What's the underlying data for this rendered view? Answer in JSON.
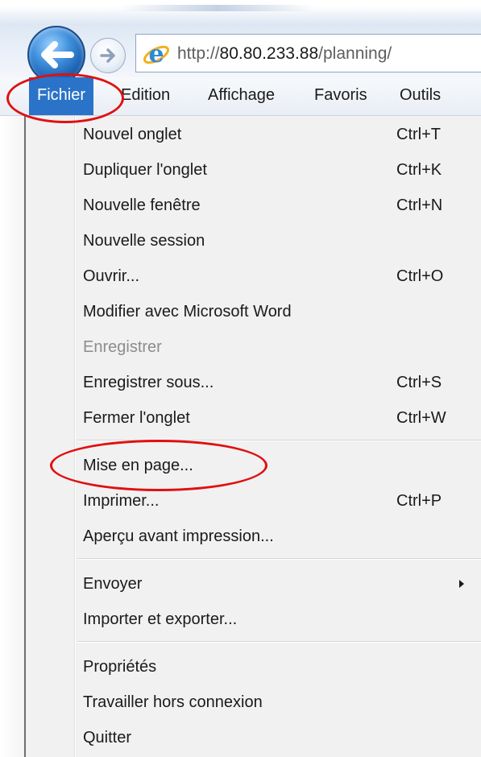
{
  "browser": {
    "address_bar": {
      "url_prefix": "http://",
      "url_host": "80.80.233.88",
      "url_path": "/planning/"
    },
    "icons": {
      "back": "back-arrow-icon",
      "forward": "forward-arrow-icon",
      "site": "internet-explorer-icon"
    },
    "accent_color": "#2b73c8",
    "highlight_color": "#e01010"
  },
  "menubar": {
    "items": [
      {
        "label": "Fichier",
        "active": true
      },
      {
        "label": "Edition"
      },
      {
        "label": "Affichage"
      },
      {
        "label": "Favoris"
      },
      {
        "label": "Outils"
      }
    ]
  },
  "file_menu": {
    "items": [
      {
        "label": "Nouvel onglet",
        "shortcut": "Ctrl+T"
      },
      {
        "label": "Dupliquer l'onglet",
        "shortcut": "Ctrl+K"
      },
      {
        "label": "Nouvelle fenêtre",
        "shortcut": "Ctrl+N"
      },
      {
        "label": "Nouvelle session",
        "shortcut": ""
      },
      {
        "label": "Ouvrir...",
        "shortcut": "Ctrl+O"
      },
      {
        "label": "Modifier avec Microsoft Word",
        "shortcut": ""
      },
      {
        "label": "Enregistrer",
        "shortcut": "",
        "disabled": true
      },
      {
        "label": "Enregistrer sous...",
        "shortcut": "Ctrl+S"
      },
      {
        "label": "Fermer l'onglet",
        "shortcut": "Ctrl+W"
      },
      {
        "label": "Mise en page...",
        "shortcut": ""
      },
      {
        "label": "Imprimer...",
        "shortcut": "Ctrl+P"
      },
      {
        "label": "Aperçu avant impression...",
        "shortcut": ""
      },
      {
        "label": "Envoyer",
        "shortcut": "",
        "submenu": true
      },
      {
        "label": "Importer et exporter...",
        "shortcut": ""
      },
      {
        "label": "Propriétés",
        "shortcut": ""
      },
      {
        "label": "Travailler hors connexion",
        "shortcut": ""
      },
      {
        "label": "Quitter",
        "shortcut": ""
      }
    ]
  }
}
